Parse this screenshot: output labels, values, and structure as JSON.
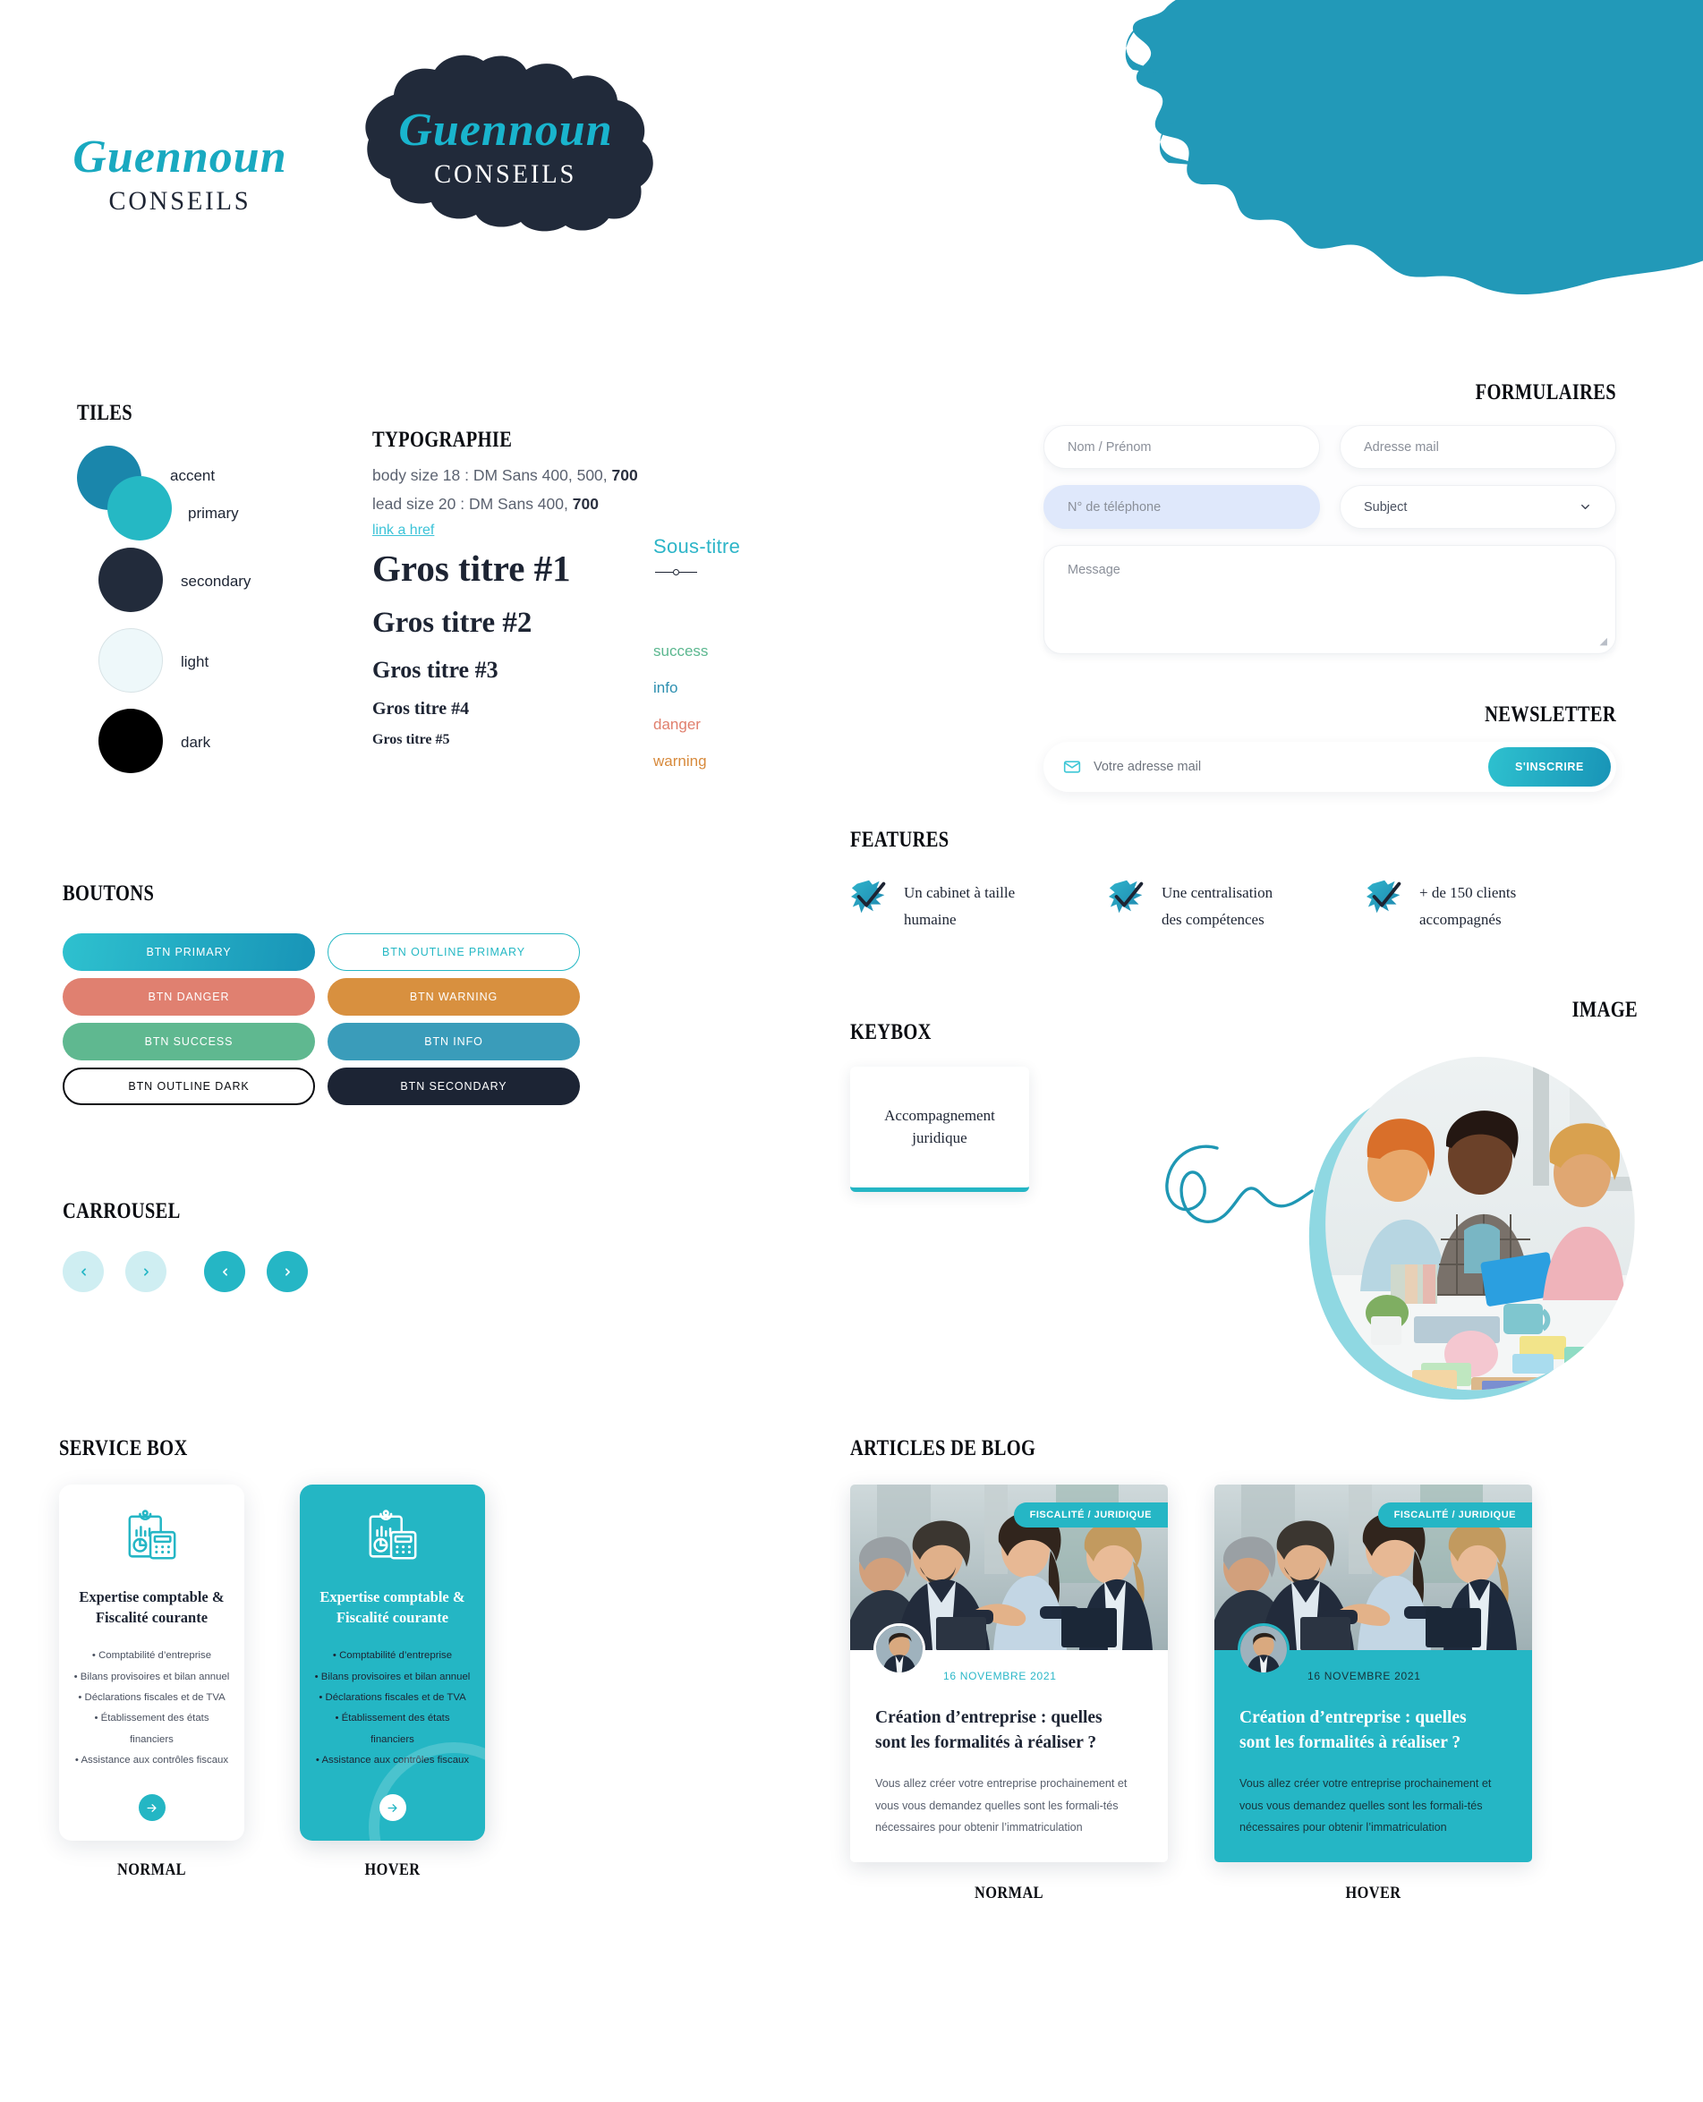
{
  "brand": {
    "script_name": "Guennoun",
    "sub_name": "CONSEILS"
  },
  "sections": {
    "tiles": "TILES",
    "typographie": "TYPOGRAPHIE",
    "boutons": "BOUTONS",
    "carrousel": "CARROUSEL",
    "service_box": "SERVICE BOX",
    "formulaires": "FORMULAIRES",
    "newsletter": "NEWSLETTER",
    "features": "FEATURES",
    "keybox": "KEYBOX",
    "image": "IMAGE",
    "articles": "ARTICLES DE BLOG"
  },
  "tiles": [
    {
      "name": "accent",
      "color": "#1a86ab"
    },
    {
      "name": "primary",
      "color": "#25b8c4"
    },
    {
      "name": "secondary",
      "color": "#222b3b"
    },
    {
      "name": "light",
      "color": "#eef8fa"
    },
    {
      "name": "dark",
      "color": "#000000"
    }
  ],
  "typography": {
    "body_line_prefix": "body size 18 : DM Sans 400, ",
    "body_line_mid": "500, ",
    "body_line_bold": "700",
    "lead_line_prefix": "lead size 20 : DM Sans 400, ",
    "lead_line_bold": "700",
    "link": "link a href",
    "headings": [
      "Gros titre #1",
      "Gros titre #2",
      "Gros titre #3",
      "Gros titre #4",
      "Gros titre #5"
    ],
    "soustitre": "Sous-titre",
    "states": [
      {
        "label": "success",
        "color": "#5bb78f"
      },
      {
        "label": "info",
        "color": "#2d8fb0"
      },
      {
        "label": "danger",
        "color": "#e07f6d"
      },
      {
        "label": "warning",
        "color": "#d78a3c"
      }
    ]
  },
  "buttons": [
    {
      "label": "BTN PRIMARY",
      "style": "primary"
    },
    {
      "label": "BTN OUTLINE PRIMARY",
      "style": "outline-primary"
    },
    {
      "label": "BTN DANGER",
      "style": "danger"
    },
    {
      "label": "BTN WARNING",
      "style": "warning"
    },
    {
      "label": "BTN SUCCESS",
      "style": "success"
    },
    {
      "label": "BTN INFO",
      "style": "info"
    },
    {
      "label": "BTN OUTLINE DARK",
      "style": "outline-dark"
    },
    {
      "label": "BTN SECONDARY",
      "style": "secondary"
    }
  ],
  "carousel": {
    "prev_light": "‹",
    "next_light": "›",
    "prev_solid": "‹",
    "next_solid": "›",
    "light_bg": "#cfeef2",
    "light_fg": "#25b6c5",
    "solid_bg": "#25b6c5",
    "solid_fg": "#ffffff"
  },
  "form": {
    "name_placeholder": "Nom / Prénom",
    "email_placeholder": "Adresse mail",
    "phone_placeholder": "N° de téléphone",
    "subject_value": "Subject",
    "message_placeholder": "Message"
  },
  "newsletter": {
    "email_placeholder": "Votre adresse mail",
    "button_label": "S'INSCRIRE"
  },
  "features": [
    {
      "line1": "Un cabinet à taille",
      "line2": "humaine"
    },
    {
      "line1": "Une centralisation",
      "line2": "des compétences"
    },
    {
      "line1": "+ de 150 clients",
      "line2": "accompagnés"
    }
  ],
  "keybox": {
    "line1": "Accompagnement",
    "line2": "juridique"
  },
  "service_box": {
    "title_line1": "Expertise comptable &",
    "title_line2": "Fiscalité courante",
    "items": [
      "• Comptabilité d’entreprise",
      "• Bilans provisoires et bilan annuel",
      "• Déclarations fiscales et de TVA",
      "• Établissement des états financiers",
      "• Assistance aux contrôles fiscaux"
    ],
    "caption_normal": "NORMAL",
    "caption_hover": "HOVER"
  },
  "article": {
    "badge": "FISCALITÉ / JURIDIQUE",
    "date": "16 NOVEMBRE 2021",
    "title_line1": "Création d’entreprise : quelles",
    "title_line2": "sont les formalités à réaliser ?",
    "excerpt": "Vous allez créer votre entreprise prochainement et vous vous demandez quelles sont les formali-tés nécessaires pour obtenir l’immatriculation",
    "caption_normal": "NORMAL",
    "caption_hover": "HOVER"
  },
  "colors": {
    "primary": "#25b8c4",
    "accent": "#1a86ab",
    "secondary": "#222b3b",
    "light": "#eef8fa",
    "dark": "#000000",
    "success": "#5bb78f",
    "info": "#2d8fb0",
    "danger": "#e07f6d",
    "warning": "#d78a3c"
  }
}
